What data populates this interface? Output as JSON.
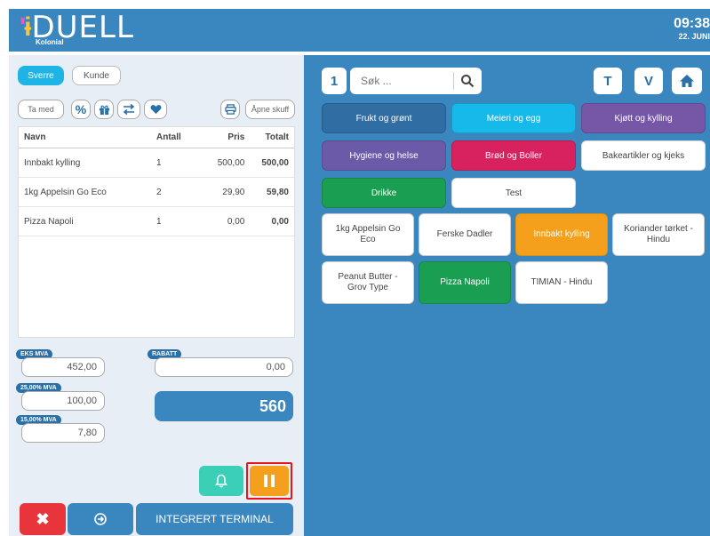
{
  "header": {
    "brand": "DUELL",
    "brand_sub": "Kolonial",
    "time": "09:38",
    "date": "22. JUNI"
  },
  "left": {
    "segments": {
      "active": "Sverre",
      "inactive": "Kunde"
    },
    "toolbar": {
      "take_with": "Ta med",
      "open_drawer": "Åpne skuff"
    },
    "table": {
      "headers": [
        "Navn",
        "Antall",
        "Pris",
        "Totalt"
      ],
      "rows": [
        {
          "name": "Innbakt kylling",
          "qty": "1",
          "price": "500,00",
          "total": "500,00"
        },
        {
          "name": "1kg Appelsin Go Eco",
          "qty": "2",
          "price": "29,90",
          "total": "59,80"
        },
        {
          "name": "Pizza Napoli",
          "qty": "1",
          "price": "0,00",
          "total": "0,00"
        }
      ]
    },
    "summary": {
      "eks_mva_label": "EKS MVA",
      "eks_mva_value": "452,00",
      "mva25_label": "25,00% MVA",
      "mva25_value": "100,00",
      "mva15_label": "15,00% MVA",
      "mva15_value": "7,80",
      "rabatt_label": "RABATT",
      "rabatt_value": "0,00",
      "total": "560"
    },
    "actions": {
      "terminal": "INTEGRERT TERMINAL"
    }
  },
  "right": {
    "key_one": "1",
    "search_placeholder": "Søk ...",
    "btn_t": "T",
    "btn_v": "V",
    "categories": [
      {
        "label": "Frukt og grønt",
        "color": "#2f6da3"
      },
      {
        "label": "Meieri og egg",
        "color": "#17b9ea"
      },
      {
        "label": "Kjøtt og kylling",
        "color": "#7556a7"
      },
      {
        "label": "Hygiene og helse",
        "color": "#6b5aa8"
      },
      {
        "label": "Brød og Boller",
        "color": "#d8225f"
      },
      {
        "label": "Bakeartikler og kjeks",
        "color": "#ffffff"
      },
      {
        "label": "Drikke",
        "color": "#1a9e52"
      },
      {
        "label": "Test",
        "color": "#ffffff"
      }
    ],
    "products": [
      {
        "label": "1kg Appelsin Go Eco"
      },
      {
        "label": "Ferske Dadler"
      },
      {
        "label": "Innbakt kylling"
      },
      {
        "label": "Koriander tørket - Hindu"
      },
      {
        "label": "Peanut Butter - Grov Type"
      },
      {
        "label": "Pizza Napoli"
      },
      {
        "label": "TIMIAN - Hindu"
      }
    ]
  }
}
